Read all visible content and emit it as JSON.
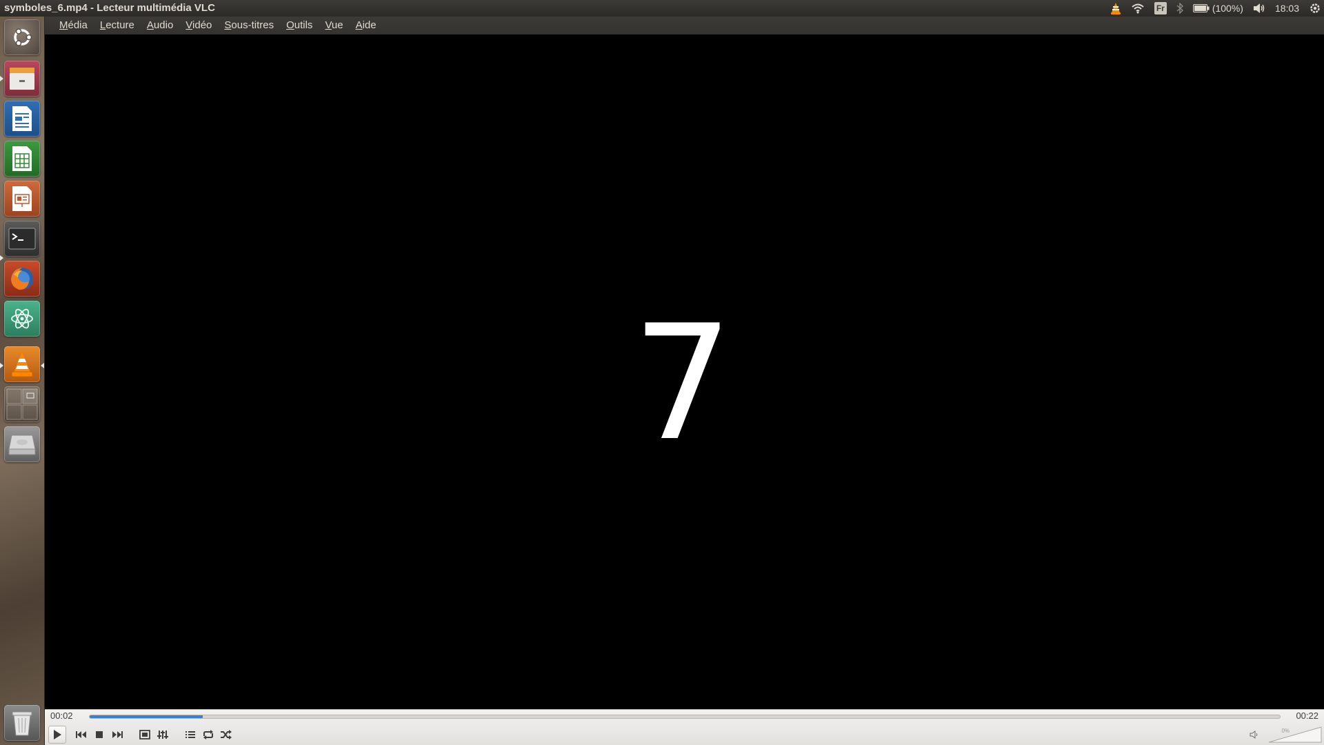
{
  "window": {
    "title": "symboles_6.mp4 - Lecteur multimédia VLC"
  },
  "indicators": {
    "vlc": "vlc-tray-icon",
    "network": "wifi-icon",
    "keyboard": "Fr",
    "bluetooth": "bluetooth-icon",
    "battery_text": "(100%)",
    "volume": "speaker-icon",
    "clock": "18:03",
    "session": "gear-icon"
  },
  "menu": {
    "items": [
      {
        "mnemonic": "M",
        "rest": "édia"
      },
      {
        "mnemonic": "L",
        "rest": "ecture"
      },
      {
        "mnemonic": "A",
        "rest": "udio"
      },
      {
        "mnemonic": "V",
        "rest": "idéo"
      },
      {
        "mnemonic": "S",
        "rest": "ous-titres"
      },
      {
        "mnemonic": "O",
        "rest": "utils"
      },
      {
        "mnemonic": "V",
        "rest": "ue"
      },
      {
        "mnemonic": "A",
        "rest": "ide"
      }
    ]
  },
  "launcher": {
    "items": [
      {
        "name": "ubuntu-dash-icon"
      },
      {
        "name": "files-icon"
      },
      {
        "name": "writer-icon"
      },
      {
        "name": "calc-icon"
      },
      {
        "name": "impress-icon"
      },
      {
        "name": "terminal-icon"
      },
      {
        "name": "firefox-icon"
      },
      {
        "name": "atom-icon"
      },
      {
        "name": "vlc-icon"
      },
      {
        "name": "workspace-switcher-icon"
      },
      {
        "name": "drive-icon"
      },
      {
        "name": "trash-icon"
      }
    ]
  },
  "video": {
    "displayed_text": "7"
  },
  "playback": {
    "elapsed": "00:02",
    "total": "00:22",
    "progress_fraction": 0.095
  },
  "controls": {
    "play": "play-icon",
    "previous": "previous-icon",
    "stop": "stop-icon",
    "next": "next-icon",
    "fullscreen": "fullscreen-icon",
    "extended": "equalizer-icon",
    "playlist": "playlist-icon",
    "loop": "loop-icon",
    "random": "shuffle-icon",
    "mute": "volume-icon"
  },
  "volume": {
    "label": "0%",
    "level_fraction": 0.0
  },
  "colors": {
    "panel": "#3c3b37",
    "seek_fill": "#3b7fd1",
    "vlc_orange": "#f28c00"
  }
}
